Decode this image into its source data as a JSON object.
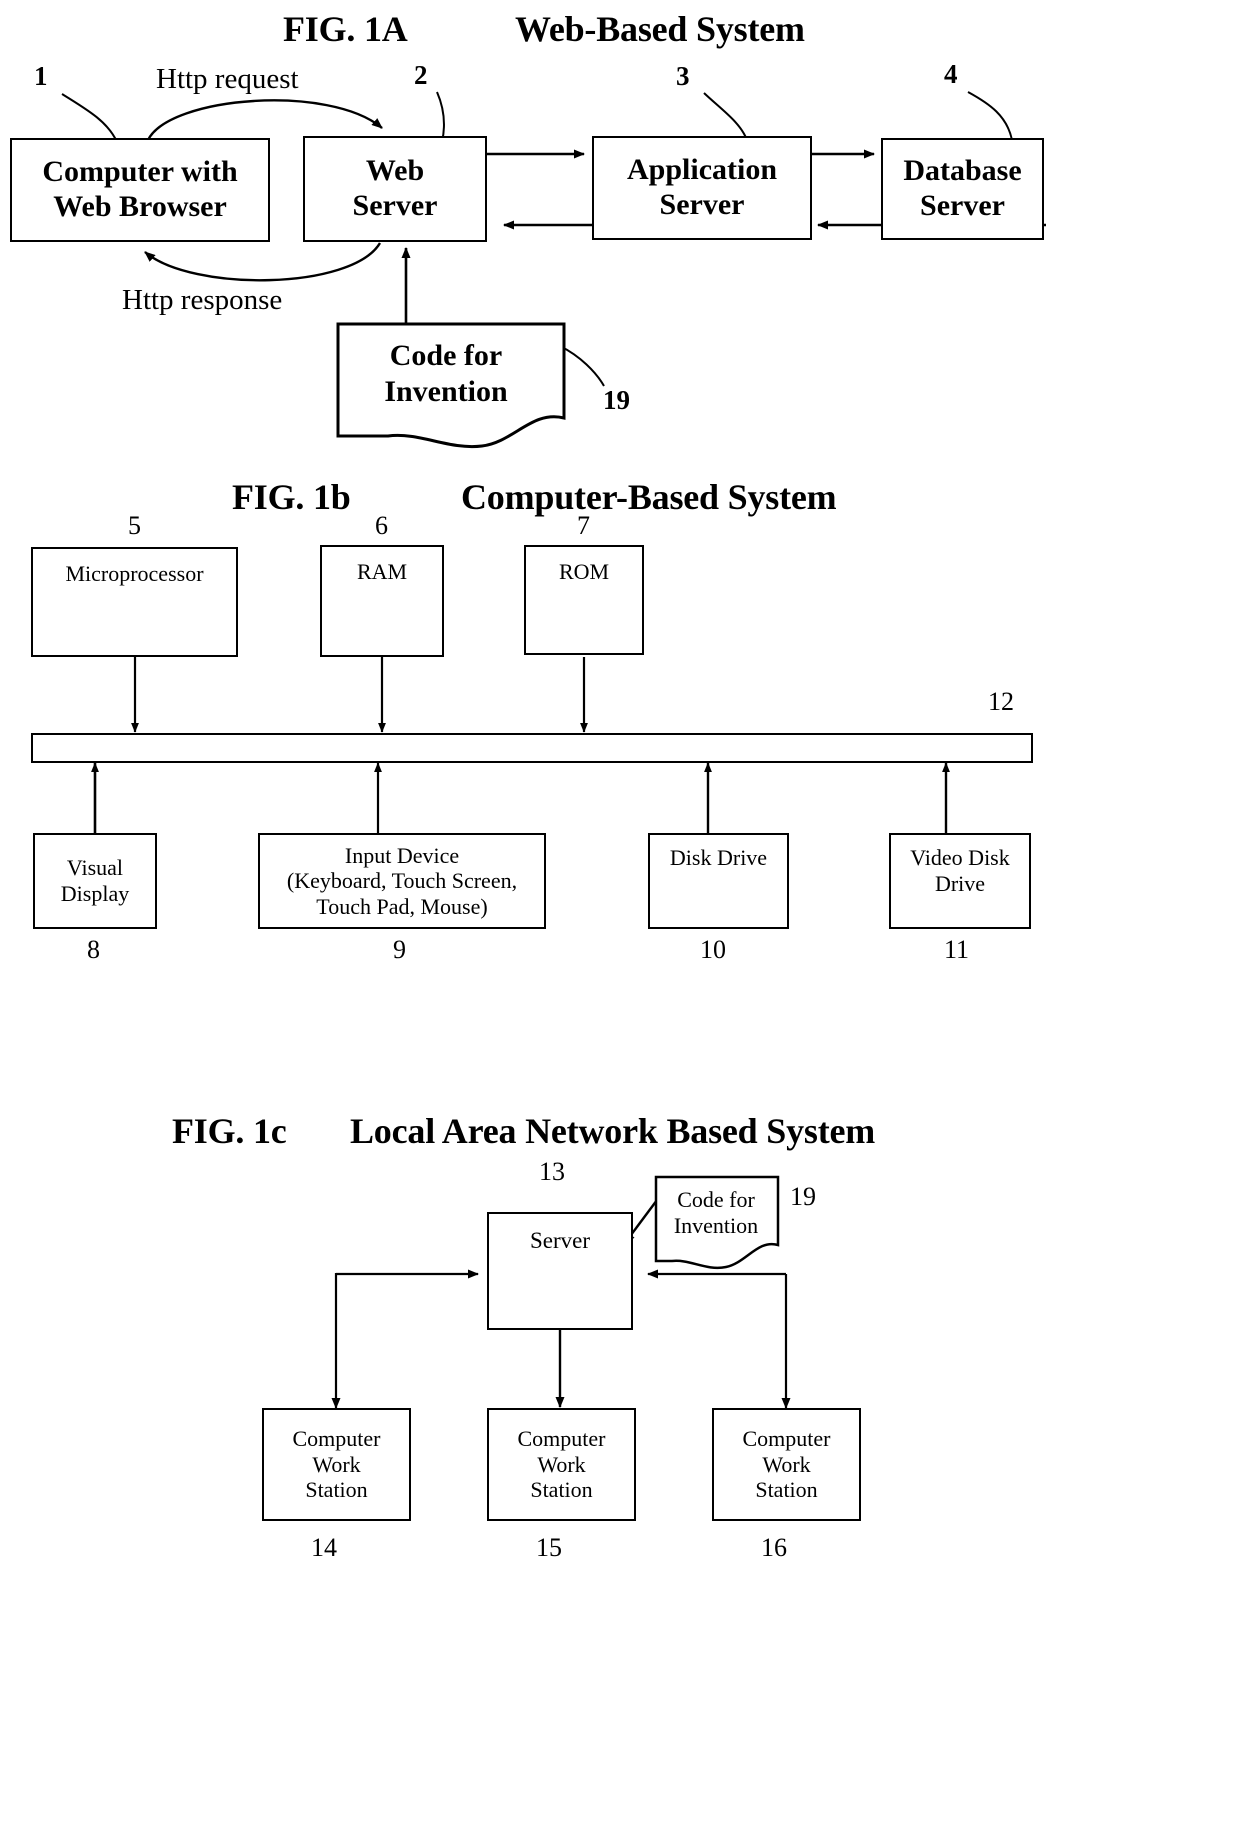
{
  "figures": [
    {
      "id": "fig1a",
      "label": "FIG. 1A",
      "title": "Web-Based System",
      "boxes": [
        {
          "name": "computer-with-web-browser",
          "text": "Computer with\nWeb Browser",
          "ref": "1"
        },
        {
          "name": "web-server",
          "text": "Web\nServer",
          "ref": "2"
        },
        {
          "name": "application-server",
          "text": "Application\nServer",
          "ref": "3"
        },
        {
          "name": "database-server",
          "text": "Database\nServer",
          "ref": "4"
        },
        {
          "name": "code-for-invention",
          "text": "Code for\nInvention",
          "ref": "19"
        }
      ],
      "edge_labels": [
        {
          "name": "http-request-label",
          "text": "Http request"
        },
        {
          "name": "http-response-label",
          "text": "Http response"
        }
      ]
    },
    {
      "id": "fig1b",
      "label": "FIG. 1b",
      "title": "Computer-Based System",
      "top_boxes": [
        {
          "name": "microprocessor",
          "text": "Microprocessor",
          "ref": "5"
        },
        {
          "name": "ram",
          "text": "RAM",
          "ref": "6"
        },
        {
          "name": "rom",
          "text": "ROM",
          "ref": "7"
        }
      ],
      "bus": {
        "name": "system-bus",
        "ref": "12"
      },
      "bottom_boxes": [
        {
          "name": "visual-display",
          "text": "Visual\nDisplay",
          "ref": "8"
        },
        {
          "name": "input-device",
          "text": "Input Device\n(Keyboard, Touch Screen,\nTouch Pad, Mouse)",
          "ref": "9"
        },
        {
          "name": "disk-drive",
          "text": "Disk Drive",
          "ref": "10"
        },
        {
          "name": "video-disk-drive",
          "text": "Video Disk\nDrive",
          "ref": "11"
        }
      ]
    },
    {
      "id": "fig1c",
      "label": "FIG. 1c",
      "title": "Local Area Network Based System",
      "server": {
        "name": "server",
        "text": "Server",
        "ref": "13"
      },
      "code": {
        "name": "code-for-invention",
        "text": "Code for\nInvention",
        "ref": "19"
      },
      "workstations": [
        {
          "name": "computer-work-station-1",
          "text": "Computer\nWork\nStation",
          "ref": "14"
        },
        {
          "name": "computer-work-station-2",
          "text": "Computer\nWork\nStation",
          "ref": "15"
        },
        {
          "name": "computer-work-station-3",
          "text": "Computer\nWork\nStation",
          "ref": "16"
        }
      ]
    }
  ],
  "colors": {
    "ink": "#000000",
    "paper": "#ffffff"
  }
}
